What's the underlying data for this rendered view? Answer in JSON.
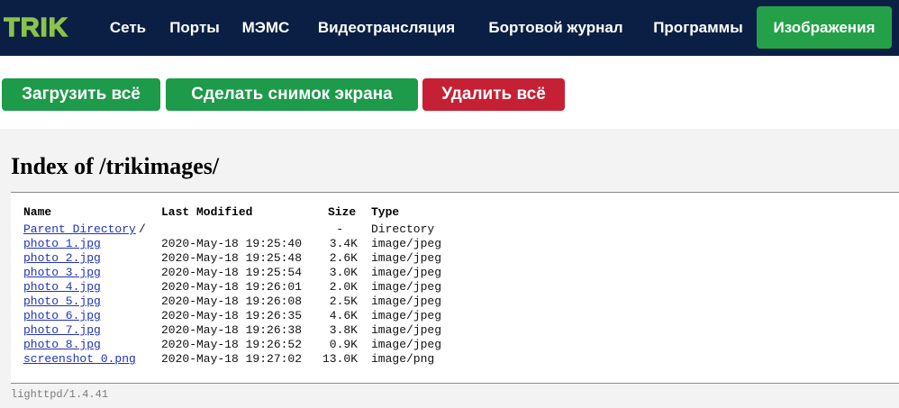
{
  "header": {
    "logo_text": "TRIK",
    "nav": [
      {
        "label": "Сеть",
        "active": false
      },
      {
        "label": "Порты",
        "active": false
      },
      {
        "label": "МЭМС",
        "active": false
      },
      {
        "label": "Видеотрансляция",
        "active": false
      },
      {
        "label": "Бортовой журнал",
        "active": false
      },
      {
        "label": "Программы",
        "active": false
      },
      {
        "label": "Изображения",
        "active": true
      }
    ]
  },
  "actions": {
    "download_all": "Загрузить всё",
    "screenshot": "Сделать снимок экрана",
    "delete_all": "Удалить всё"
  },
  "listing": {
    "title": "Index of /trikimages/",
    "columns": {
      "name": "Name",
      "modified": "Last Modified",
      "size": "Size",
      "type": "Type"
    },
    "parent": {
      "label": "Parent Directory",
      "suffix": "/",
      "size": "-",
      "type": "Directory"
    },
    "files": [
      {
        "name": "photo_1.jpg",
        "modified": "2020-May-18 19:25:40",
        "size": "3.4K",
        "type": "image/jpeg"
      },
      {
        "name": "photo_2.jpg",
        "modified": "2020-May-18 19:25:48",
        "size": "2.6K",
        "type": "image/jpeg"
      },
      {
        "name": "photo_3.jpg",
        "modified": "2020-May-18 19:25:54",
        "size": "3.0K",
        "type": "image/jpeg"
      },
      {
        "name": "photo_4.jpg",
        "modified": "2020-May-18 19:26:01",
        "size": "2.0K",
        "type": "image/jpeg"
      },
      {
        "name": "photo_5.jpg",
        "modified": "2020-May-18 19:26:08",
        "size": "2.5K",
        "type": "image/jpeg"
      },
      {
        "name": "photo_6.jpg",
        "modified": "2020-May-18 19:26:35",
        "size": "4.6K",
        "type": "image/jpeg"
      },
      {
        "name": "photo_7.jpg",
        "modified": "2020-May-18 19:26:38",
        "size": "3.8K",
        "type": "image/jpeg"
      },
      {
        "name": "photo_8.jpg",
        "modified": "2020-May-18 19:26:52",
        "size": "0.9K",
        "type": "image/jpeg"
      },
      {
        "name": "screenshot_0.png",
        "modified": "2020-May-18 19:27:02",
        "size": "13.0K",
        "type": "image/png"
      }
    ],
    "server": "lighttpd/1.4.41"
  },
  "colors": {
    "navbar": "#0b1f45",
    "active_tab": "#24a148",
    "primary_button": "#1d9a4a",
    "danger_button": "#c52033",
    "link": "#2233bb"
  }
}
